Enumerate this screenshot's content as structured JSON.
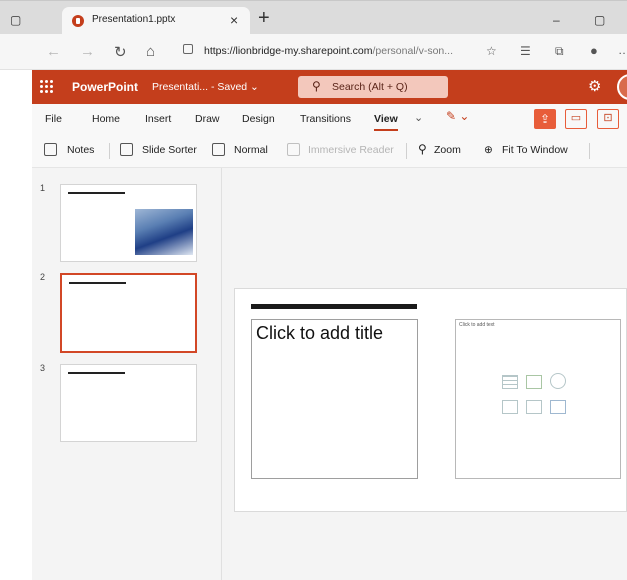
{
  "browser": {
    "tab_title": "Presentation1.pptx",
    "tab_close": "×",
    "new_tab": "+",
    "minimize": "–",
    "maximize": "▢",
    "url_host": "https://lionbridge-my.sharepoint.com",
    "url_path": "/personal/v-son...",
    "icons": [
      "back-icon",
      "forward-icon",
      "refresh-icon",
      "home-icon",
      "lock-icon",
      "favorites-icon",
      "collections-icon",
      "extensions-icon",
      "profile-icon",
      "more-icon"
    ]
  },
  "app": {
    "name": "PowerPoint",
    "doc_status": "Presentati... - Saved ⌄",
    "search_placeholder": "Search (Alt + Q)",
    "brand_color": "#c43e1c"
  },
  "ribbon": {
    "tabs": [
      "File",
      "Home",
      "Insert",
      "Draw",
      "Design",
      "Transitions",
      "View"
    ],
    "active_tab": "View",
    "more_chevron": "⌄"
  },
  "commands": {
    "notes": "Notes",
    "slide_sorter": "Slide Sorter",
    "normal": "Normal",
    "immersive_reader": "Immersive Reader",
    "zoom": "Zoom",
    "fit_to_window": "Fit To Window"
  },
  "thumbnails": [
    {
      "number": "1",
      "has_image": true,
      "selected": false
    },
    {
      "number": "2",
      "has_image": false,
      "selected": true
    },
    {
      "number": "3",
      "has_image": false,
      "selected": false
    }
  ],
  "slide": {
    "title_placeholder": "Click to add title",
    "content_placeholder": "Click to add text"
  }
}
